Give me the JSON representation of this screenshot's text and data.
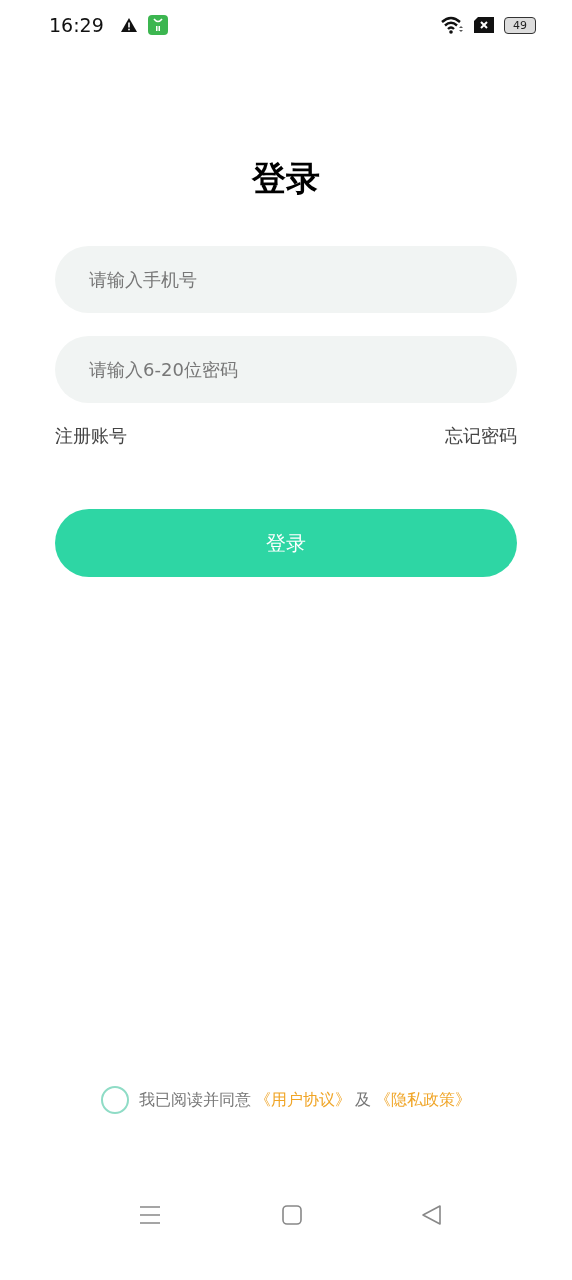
{
  "status_bar": {
    "time": "16:29",
    "battery": "49"
  },
  "title": "登录",
  "fields": [
    {
      "placeholder": "请输入手机号"
    },
    {
      "placeholder": "请输入6-20位密码"
    }
  ],
  "links": {
    "register": "注册账号",
    "forgot": "忘记密码"
  },
  "login_button": "登录",
  "agreement": {
    "checked": false,
    "prefix": "我已阅读并同意",
    "user_agreement": "《用户协议》",
    "conjunction": "及",
    "privacy_policy": "《隐私政策》"
  }
}
